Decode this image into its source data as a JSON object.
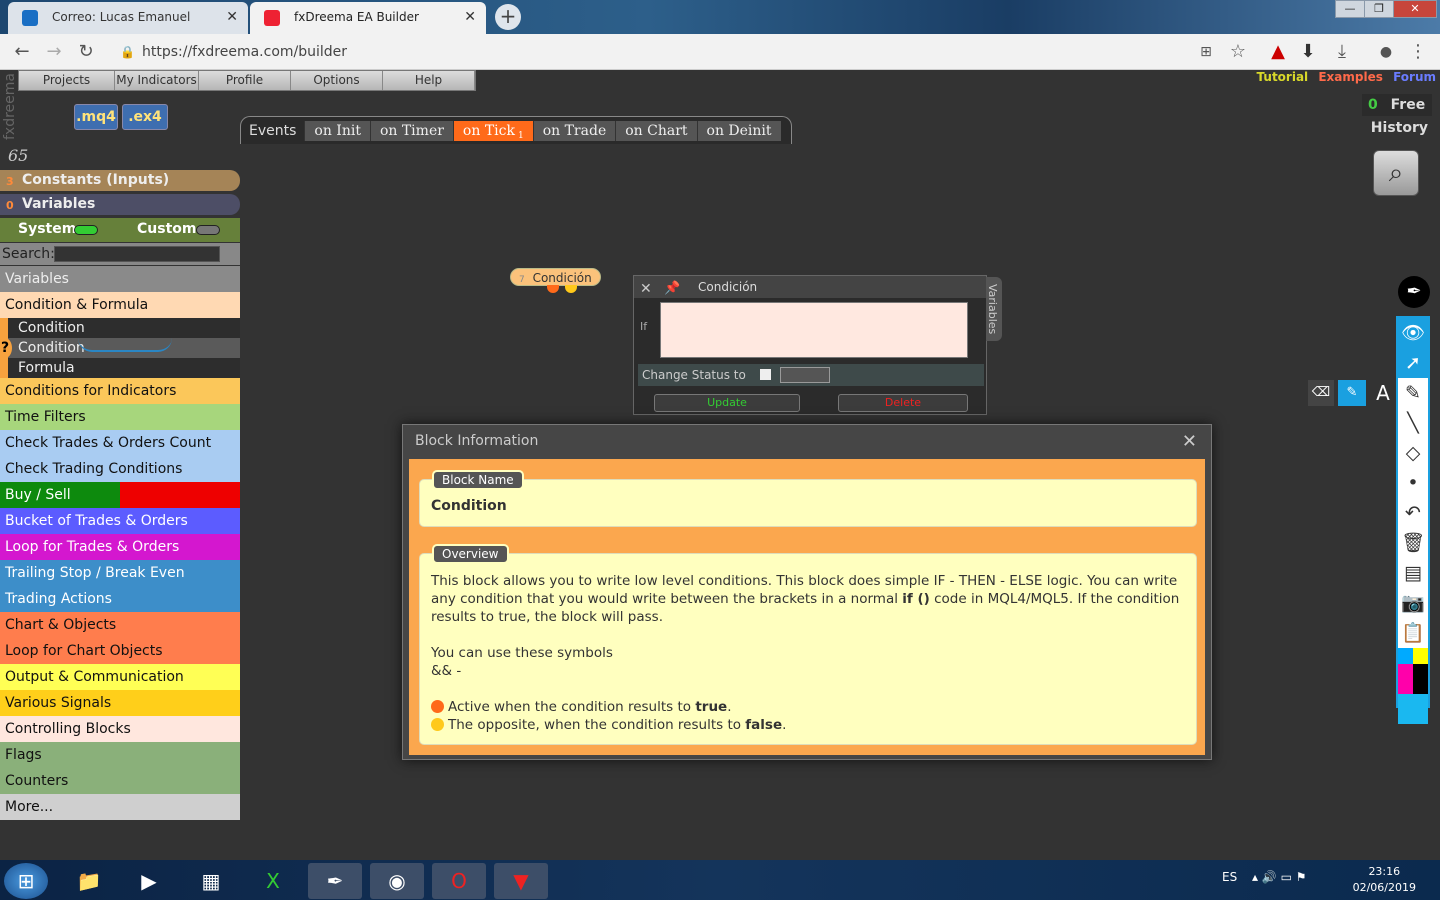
{
  "browser": {
    "tabs": [
      {
        "title": "Correo: Lucas Emanuel Martinez"
      },
      {
        "title": "fxDreema EA Builder"
      }
    ],
    "url": "https://fxdreema.com/builder"
  },
  "app": {
    "brand": "fxdreema",
    "menu": [
      "Projects",
      "My Indicators",
      "Profile",
      "Options",
      "Help"
    ],
    "file_buttons": [
      ".mq4",
      ".ex4"
    ],
    "links": {
      "tutorial": "Tutorial",
      "examples": "Examples",
      "forum": "Forum"
    },
    "free_count": "0",
    "free_label": "Free",
    "history": "History",
    "events_label": "Events",
    "events": [
      "on Init",
      "on Timer",
      "on Tick",
      "on Trade",
      "on Chart",
      "on Deinit"
    ],
    "active_event_badge": "1",
    "counter": "65",
    "constants": {
      "count": "3",
      "label": "Constants (Inputs)"
    },
    "variables": {
      "count": "0",
      "label": "Variables"
    },
    "system_label": "System",
    "custom_label": "Custom",
    "search_label": "Search:",
    "categories": [
      {
        "label": "Variables",
        "bg": "#8a8a8a"
      },
      {
        "label": "Condition & Formula",
        "bg": "#ffd9b3"
      },
      {
        "label": "Conditions for Indicators",
        "bg": "#fbc75a"
      },
      {
        "label": "Time Filters",
        "bg": "#a7d67c"
      },
      {
        "label": "Check Trades & Orders Count",
        "bg": "#a9ccf2"
      },
      {
        "label": "Check Trading Conditions",
        "bg": "#a9ccf2"
      },
      {
        "label": "Buy / Sell",
        "bg": "#0d8a0d"
      },
      {
        "label": "Bucket of Trades & Orders",
        "bg": "#5c5cff"
      },
      {
        "label": "Loop for Trades & Orders",
        "bg": "#d417cf"
      },
      {
        "label": "Trailing Stop / Break Even",
        "bg": "#3d8ec9"
      },
      {
        "label": "Trading Actions",
        "bg": "#3d8ec9"
      },
      {
        "label": "Chart & Objects",
        "bg": "#ff7d4d"
      },
      {
        "label": "Loop for Chart Objects",
        "bg": "#ff7d4d"
      },
      {
        "label": "Output & Communication",
        "bg": "#ffff55"
      },
      {
        "label": "Various Signals",
        "bg": "#ffcf1a"
      },
      {
        "label": "Controlling Blocks",
        "bg": "#ffe7de"
      },
      {
        "label": "Flags",
        "bg": "#8ab07a"
      },
      {
        "label": "Counters",
        "bg": "#8ab07a"
      },
      {
        "label": "More...",
        "bg": "#cfcfcf"
      }
    ],
    "subitems": [
      "Condition",
      "Condition",
      "Formula"
    ],
    "help_mark": "?",
    "canvas_block": {
      "number": "7",
      "label": "Condición"
    },
    "condition_popup": {
      "title": "Condición",
      "if_label": "If",
      "status_label": "Change Status to",
      "update": "Update",
      "delete": "Delete",
      "side_tab": "Variables"
    },
    "info": {
      "title": "Block Information",
      "name_legend": "Block Name",
      "name": "Condition",
      "overview_legend": "Overview",
      "p1a": "This block allows you to write low level conditions. This block does simple IF - THEN - ELSE logic. You can write any condition that you would write between the brackets in a normal ",
      "p1b": "if ()",
      "p1c": " code in MQL4/MQL5. If the condition results to true, the block will pass.",
      "p2": "You can use these symbols",
      "p3": "&& -",
      "l1a": "Active when the condition results to ",
      "l1b": "true",
      "l2a": "The opposite, when the condition results to ",
      "l2b": "false",
      "dot_orange": "#ff6a1a",
      "dot_yellow": "#ffc91a"
    }
  },
  "taskbar": {
    "lang": "ES",
    "time": "23:16",
    "date": "02/06/2019"
  }
}
